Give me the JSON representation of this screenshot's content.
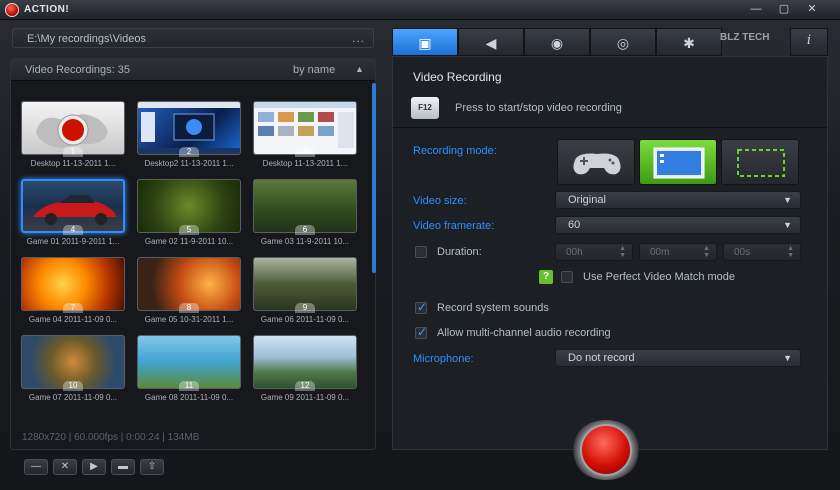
{
  "window": {
    "title": "ACTION!"
  },
  "path_bar": {
    "path": "E:\\My recordings\\Videos",
    "more": "..."
  },
  "recordings": {
    "title": "Video Recordings: 35",
    "sort": "by name",
    "items": [
      {
        "num": "1",
        "caption": "Desktop 11-13-2011 1..."
      },
      {
        "num": "2",
        "caption": "Desktop2 11-13-2011 1..."
      },
      {
        "num": "3",
        "caption": "Desktop 11-13-2011 1..."
      },
      {
        "num": "4",
        "caption": "Game 01 2011-9-2011 1..."
      },
      {
        "num": "5",
        "caption": "Game 02 11-9-2011 10..."
      },
      {
        "num": "6",
        "caption": "Game 03 11-9-2011 10..."
      },
      {
        "num": "7",
        "caption": "Game 04 2011-11-09 0..."
      },
      {
        "num": "8",
        "caption": "Game 05 10-31-2011 1..."
      },
      {
        "num": "9",
        "caption": "Game 06 2011-11-09 0..."
      },
      {
        "num": "10",
        "caption": "Game 07 2011-11-09 0..."
      },
      {
        "num": "11",
        "caption": "Game 08 2011-11-09 0..."
      },
      {
        "num": "12",
        "caption": "Game 09 2011-11-09 0..."
      }
    ],
    "status": "1280x720 | 60.000fps | 0:00:24 | 134MB"
  },
  "tabs": {
    "items": [
      "video-icon",
      "speaker-icon",
      "webcam-icon",
      "camera-icon",
      "gear-icon"
    ],
    "info": "i",
    "watermark": "BLZ TECH"
  },
  "settings": {
    "section_title": "Video Recording",
    "hotkey": "F12",
    "hotkey_desc": "Press to start/stop video recording",
    "recording_mode_label": "Recording mode:",
    "video_size_label": "Video size:",
    "video_size_value": "Original",
    "video_framerate_label": "Video framerate:",
    "video_framerate_value": "60",
    "duration_label": "Duration:",
    "duration_h": "00h",
    "duration_m": "00m",
    "duration_s": "00s",
    "perfect_match_label": "Use Perfect Video Match mode",
    "help": "?",
    "record_sounds_label": "Record system sounds",
    "multichannel_label": "Allow multi-channel audio recording",
    "microphone_label": "Microphone:",
    "microphone_value": "Do not record"
  },
  "colors": {
    "accent": "#2f8fff",
    "record": "#d40f05",
    "mode_active": "#5cbf24"
  }
}
